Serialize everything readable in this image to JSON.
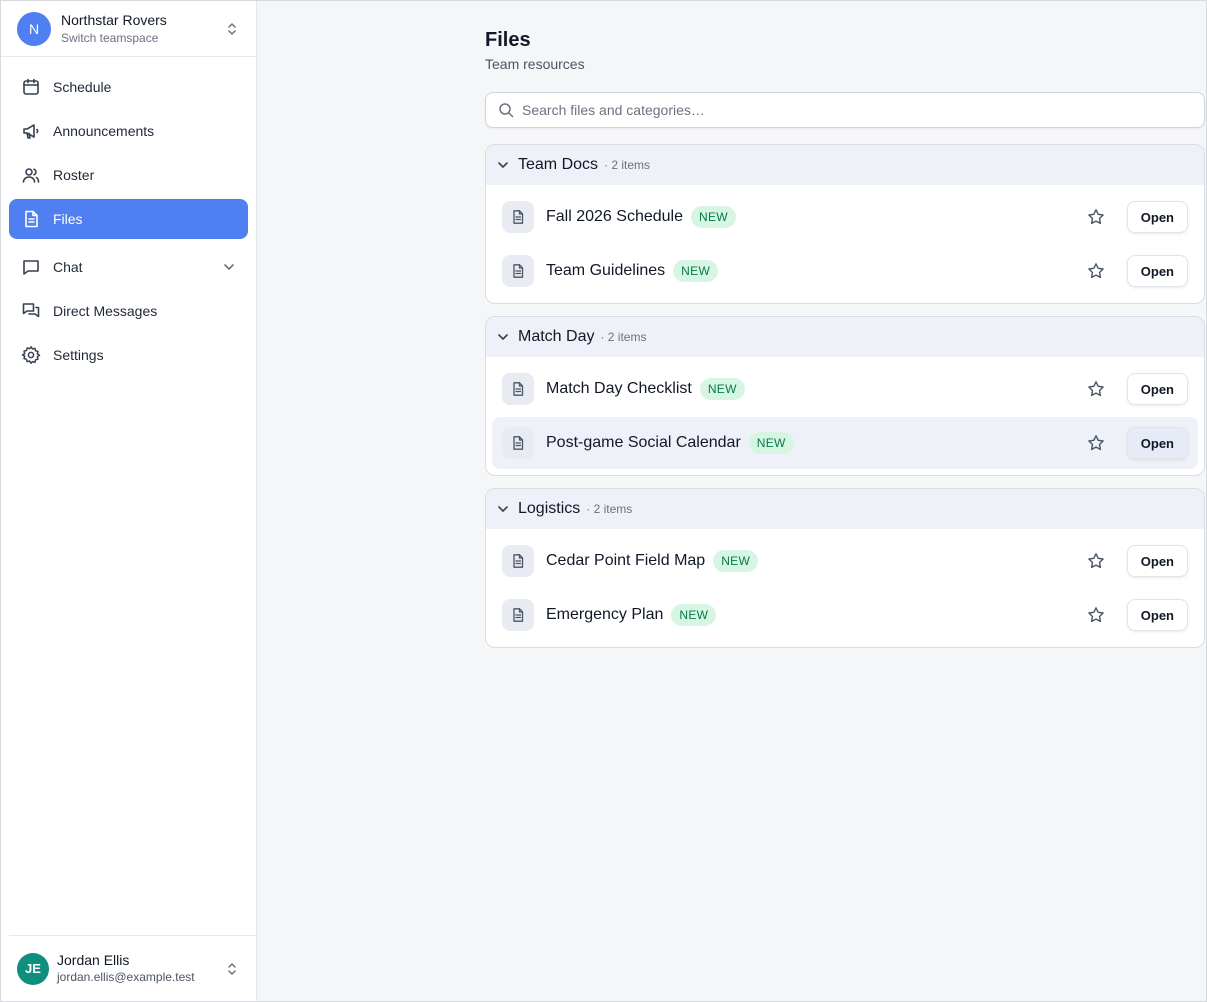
{
  "team": {
    "initial": "N",
    "name": "Northstar Rovers",
    "subtitle": "Switch teamspace"
  },
  "nav": [
    {
      "label": "Schedule",
      "icon": "calendar-icon"
    },
    {
      "label": "Announcements",
      "icon": "megaphone-icon"
    },
    {
      "label": "Roster",
      "icon": "users-icon"
    },
    {
      "label": "Files",
      "icon": "file-icon",
      "active": true
    },
    {
      "label": "Chat",
      "icon": "chat-icon",
      "expandable": true
    },
    {
      "label": "Direct Messages",
      "icon": "messages-icon"
    },
    {
      "label": "Settings",
      "icon": "gear-icon"
    }
  ],
  "user": {
    "initials": "JE",
    "name": "Jordan Ellis",
    "email": "jordan.ellis@example.test"
  },
  "page": {
    "title": "Files",
    "subtitle": "Team resources"
  },
  "search": {
    "placeholder": "Search files and categories…",
    "value": ""
  },
  "groups": [
    {
      "title": "Team Docs",
      "count": "· 2 items",
      "files": [
        {
          "name": "Fall 2026 Schedule",
          "badge": "NEW",
          "action": "Open"
        },
        {
          "name": "Team Guidelines",
          "badge": "NEW",
          "action": "Open"
        }
      ]
    },
    {
      "title": "Match Day",
      "count": "· 2 items",
      "files": [
        {
          "name": "Match Day Checklist",
          "badge": "NEW",
          "action": "Open"
        },
        {
          "name": "Post-game Social Calendar",
          "badge": "NEW",
          "action": "Open"
        }
      ]
    },
    {
      "title": "Logistics",
      "count": "· 2 items",
      "files": [
        {
          "name": "Cedar Point Field Map",
          "badge": "NEW",
          "action": "Open"
        },
        {
          "name": "Emergency Plan",
          "badge": "NEW",
          "action": "Open"
        }
      ]
    }
  ],
  "colors": {
    "accent": "#4f7ff0",
    "badge_bg": "#d7f5e3",
    "badge_text": "#067a4a",
    "user_avatar": "#0f8f7e"
  }
}
